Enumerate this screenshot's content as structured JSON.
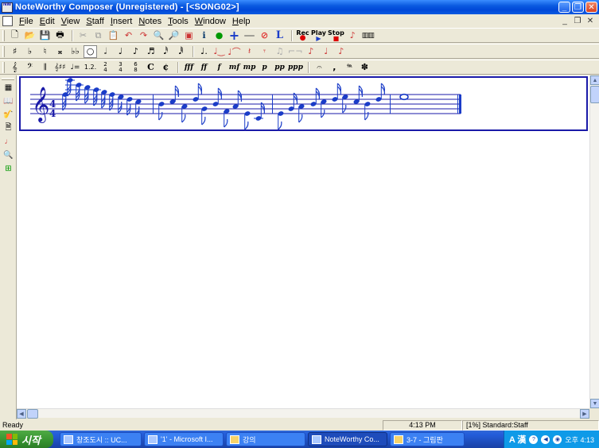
{
  "window": {
    "title": "NoteWorthy Composer (Unregistered) - [<SONG02>]",
    "app_icon_text": "NW"
  },
  "menu": [
    "File",
    "Edit",
    "View",
    "Staff",
    "Insert",
    "Notes",
    "Tools",
    "Window",
    "Help"
  ],
  "toolbar1": {
    "rec_label": "Rec",
    "play_label": "Play",
    "stop_label": "Stop",
    "lyric_label": "L"
  },
  "toolbar3": {
    "dynamics": [
      "fff",
      "ff",
      "f",
      "mf",
      "mp",
      "p",
      "pp",
      "ppp"
    ]
  },
  "score": {
    "time_signature_top": "4",
    "time_signature_bottom": "4"
  },
  "status": {
    "ready": "Ready",
    "time": "4:13 PM",
    "staff": "[1%] Standard:Staff"
  },
  "taskbar": {
    "start_label": "시작",
    "buttons": [
      {
        "label": "창조도시 :: UC...",
        "active": false
      },
      {
        "label": "'1' - Microsoft I...",
        "active": false
      },
      {
        "label": "강의",
        "active": false
      },
      {
        "label": "NoteWorthy Co...",
        "active": true
      },
      {
        "label": "3-7 - 그림판",
        "active": false
      }
    ],
    "ime": "A 漢",
    "clock": "오후 4:13"
  },
  "colors": {
    "title_bar": "#0a5ae0",
    "note_color": "#1a3cc8",
    "staff_border": "#1a1aa8"
  }
}
